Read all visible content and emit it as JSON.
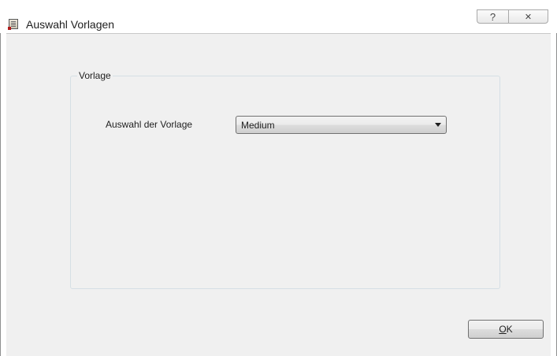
{
  "window": {
    "title": "Auswahl Vorlagen",
    "icon": "document-icon",
    "help_symbol": "?",
    "close_symbol": "✕"
  },
  "group": {
    "legend": "Vorlage",
    "field_label": "Auswahl der Vorlage",
    "template_select": {
      "value": "Medium"
    }
  },
  "buttons": {
    "ok_mnemonic": "O",
    "ok_rest": "K"
  }
}
